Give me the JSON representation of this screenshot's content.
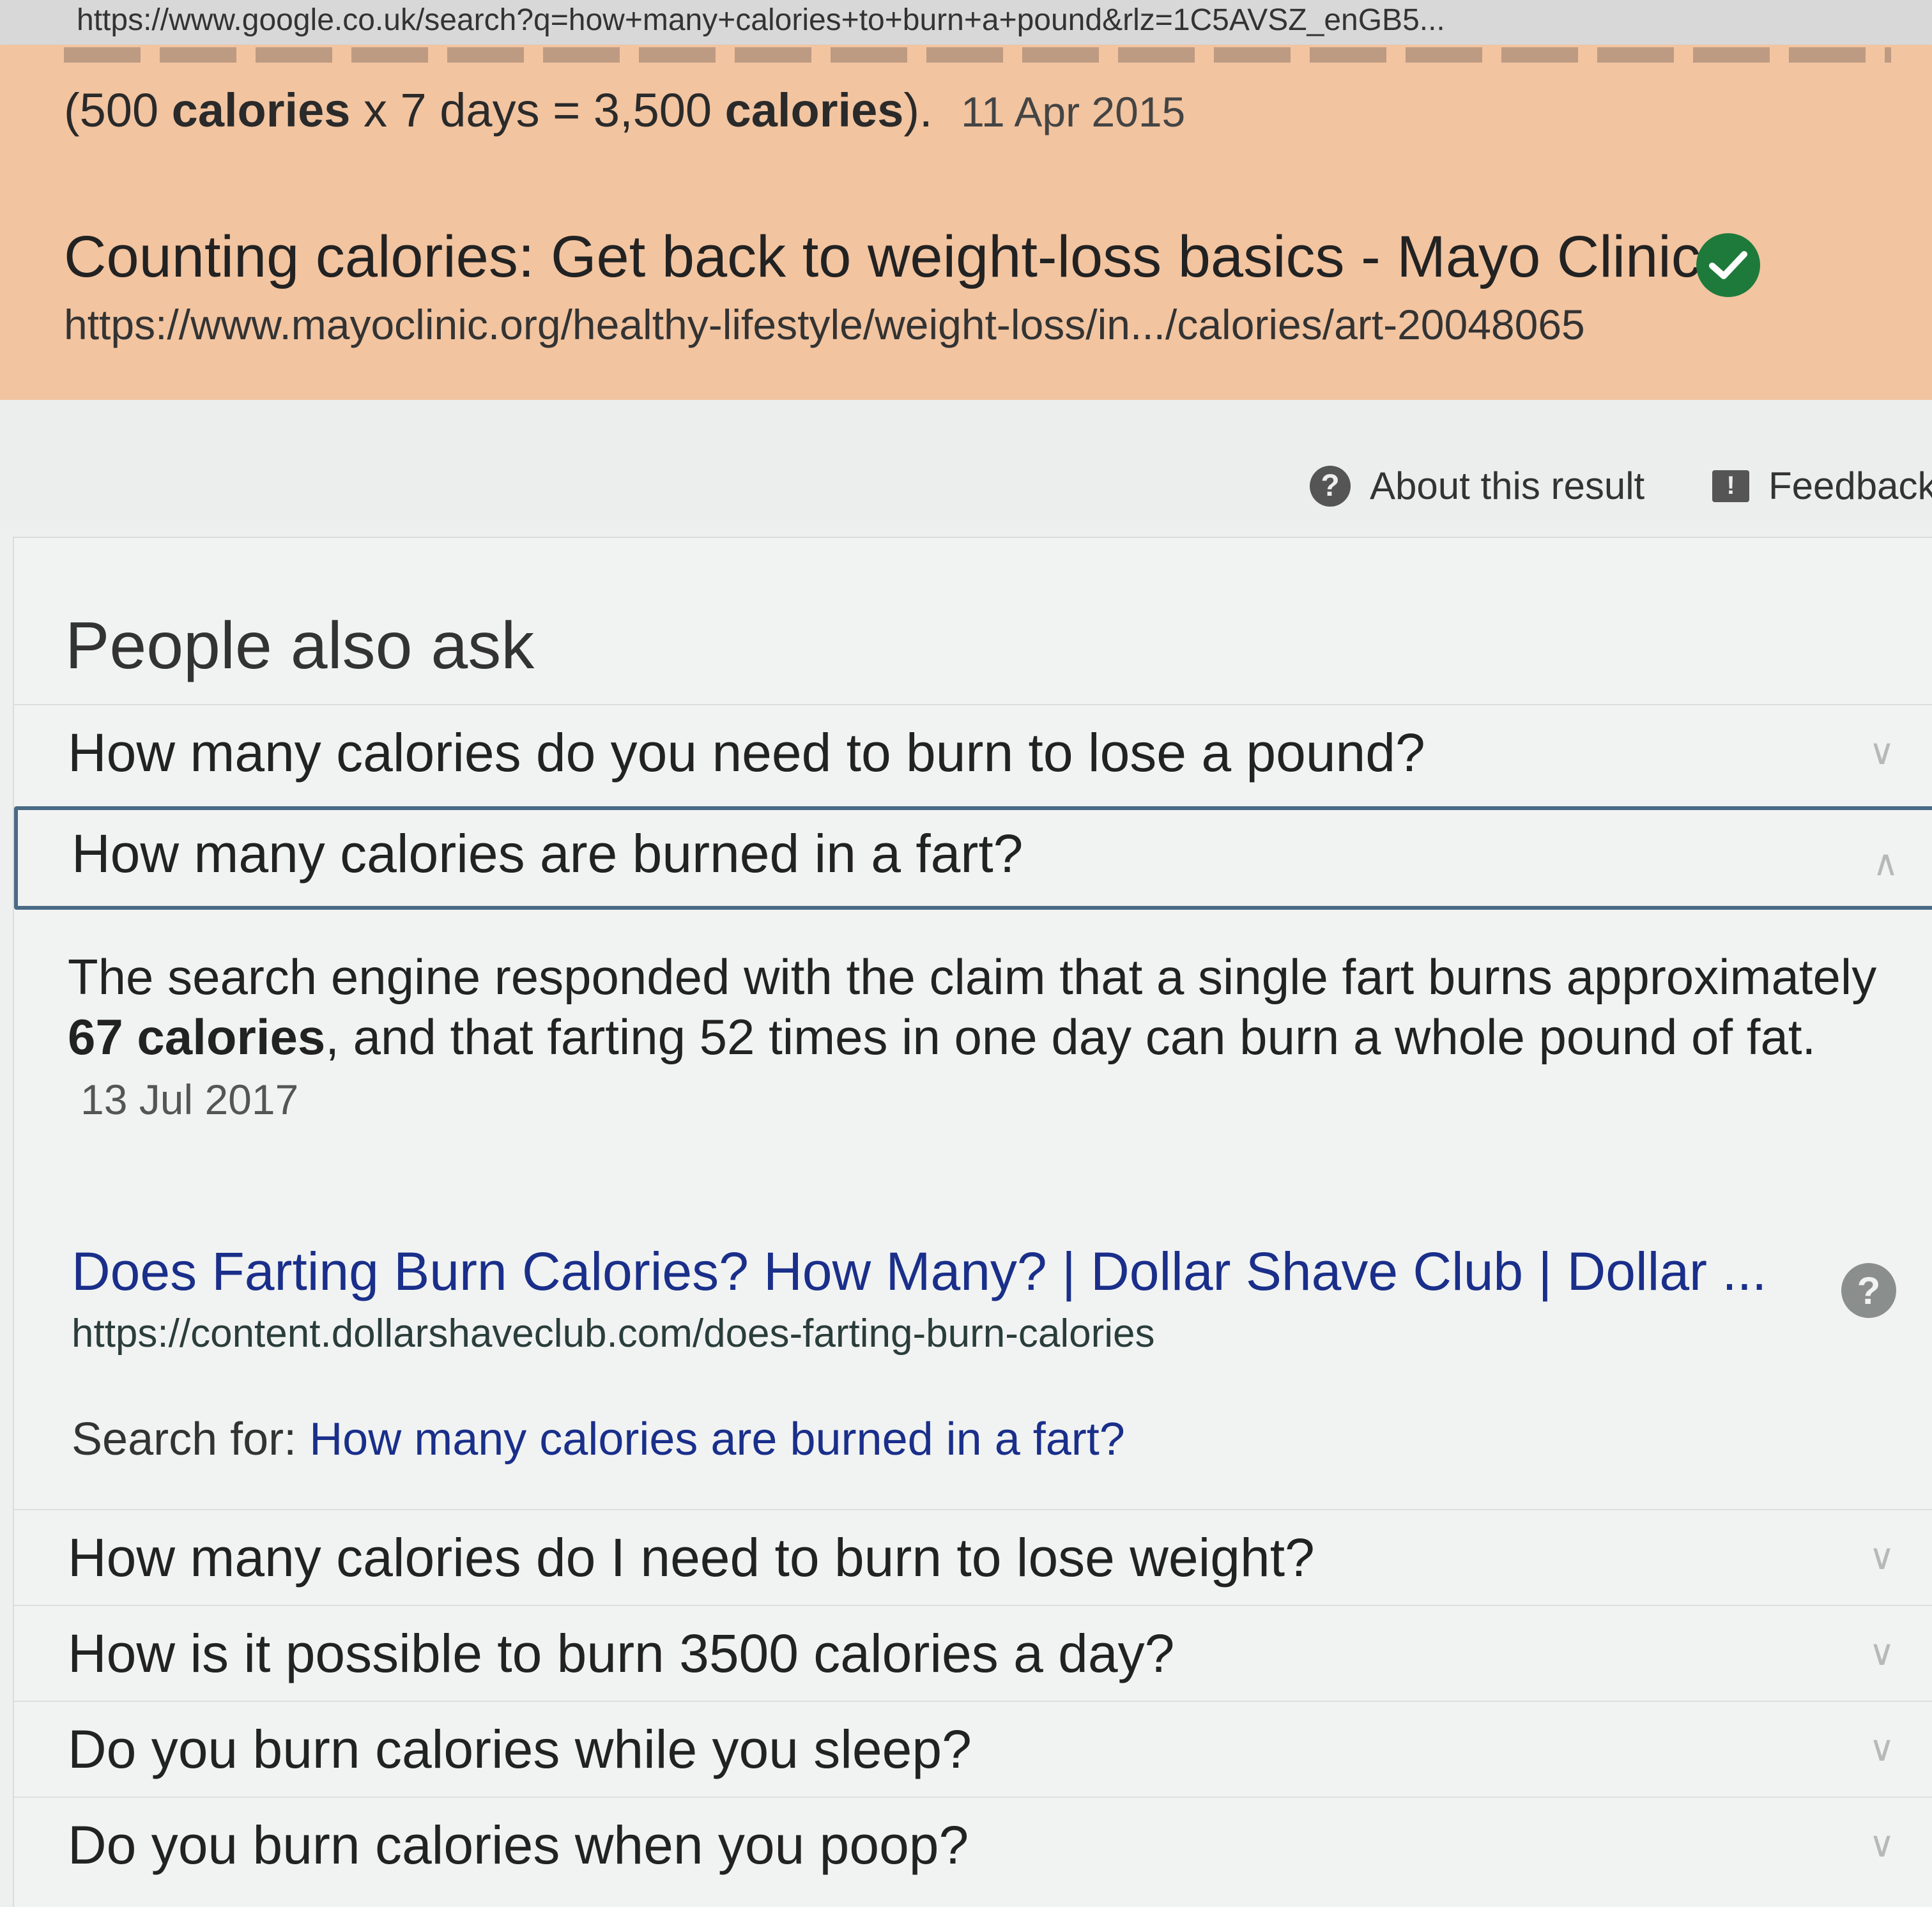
{
  "browser": {
    "url": "https://www.google.co.uk/search?q=how+many+calories+to+burn+a+pound&rlz=1C5AVSZ_enGB5..."
  },
  "snippet": {
    "text_pre": "(500 ",
    "bold1": "calories",
    "text_mid": " x 7 days = 3,500 ",
    "bold2": "calories",
    "text_post": ").",
    "date": "11 Apr 2015",
    "title": "Counting calories: Get back to weight-loss basics - Mayo Clinic",
    "link": "https://www.mayoclinic.org/healthy-lifestyle/weight-loss/in.../calories/art-20048065"
  },
  "about": {
    "about_label": "About this result",
    "feedback_label": "Feedback"
  },
  "paa": {
    "title": "People also ask",
    "q1": "How many calories do you need to burn to lose a pound?",
    "q2": "How many calories are burned in a fart?",
    "answer_pre": "The search engine responded with the claim that a single fart burns approximately ",
    "answer_bold": "67 calories",
    "answer_post": ", and that farting 52 times in one day can burn a whole pound of fat.",
    "answer_date": "13 Jul 2017",
    "result_title": "Does Farting Burn Calories? How Many? | Dollar Shave Club | Dollar ...",
    "result_url": "https://content.dollarshaveclub.com/does-farting-burn-calories",
    "search_for_label": "Search for:",
    "search_for_link": "How many calories are burned in a fart?",
    "q3": "How many calories do I need to burn to lose weight?",
    "q4": "How is it possible to burn 3500 calories a day?",
    "q5": "Do you burn calories while you sleep?",
    "q6": "Do you burn calories when you poop?"
  },
  "icons": {
    "verified": "check-circle-icon",
    "about": "question-circle-icon",
    "feedback": "feedback-icon",
    "chevron_down": "chevron-down-icon",
    "chevron_up": "chevron-up-icon",
    "info": "info-icon"
  },
  "colors": {
    "snippet_bg": "#f2c4a0",
    "verified_green": "#1e7a3a",
    "link_blue": "#1a2f8a",
    "open_border": "#4a6a86"
  }
}
